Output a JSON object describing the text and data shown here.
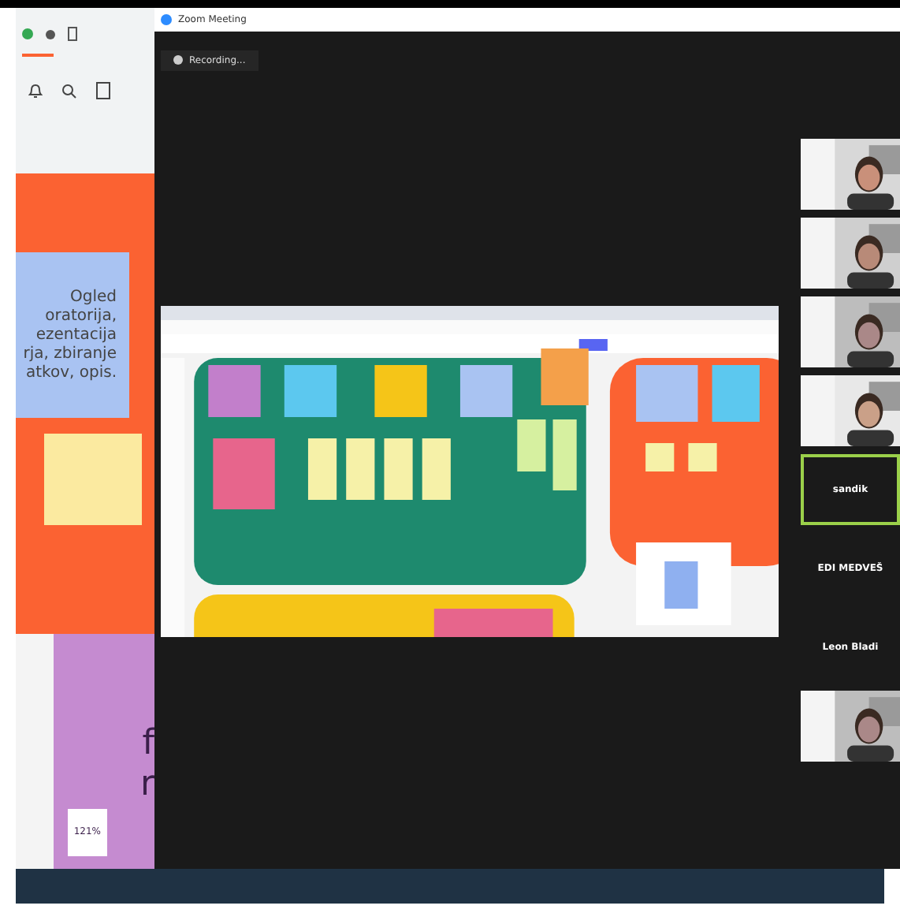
{
  "zoom_window": {
    "title": "Zoom Meeting",
    "recording": "Recording..."
  },
  "left_page": {
    "note_lines": [
      "Ogled",
      "oratorija,",
      "ezentacija",
      "rja, zbiranje",
      "atkov, opis."
    ],
    "slide_letters": [
      "f",
      "r"
    ],
    "zoom_level": "121%"
  },
  "participants": [
    {
      "kind": "video",
      "selected": false
    },
    {
      "kind": "video",
      "selected": false
    },
    {
      "kind": "video",
      "selected": false
    },
    {
      "kind": "video",
      "selected": false
    },
    {
      "kind": "name",
      "name": "sandik",
      "selected": true
    },
    {
      "kind": "name",
      "name": "EDI MEDVEŠ",
      "selected": false
    },
    {
      "kind": "name",
      "name": "Leon Bladi",
      "selected": false
    },
    {
      "kind": "video",
      "selected": false
    }
  ]
}
